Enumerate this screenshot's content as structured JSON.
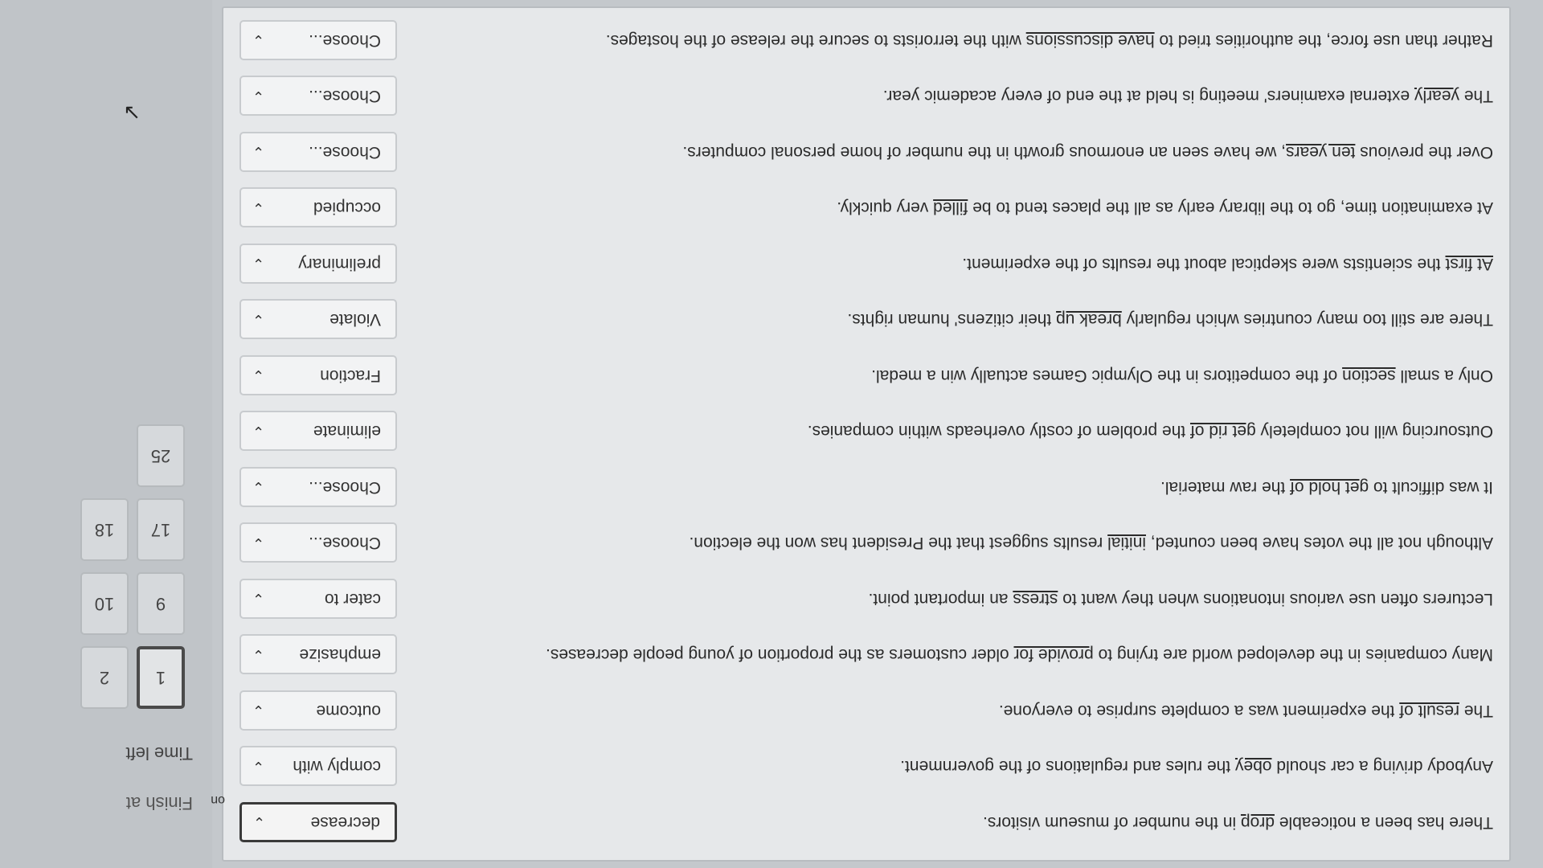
{
  "sidebar": {
    "finish_label": "Finish at",
    "time_label": "Time left",
    "side_label": "on",
    "nav": [
      "1",
      "2",
      "9",
      "10",
      "17",
      "18",
      "25"
    ]
  },
  "questions": [
    {
      "pre": "There has been a noticeable ",
      "u": "drop",
      "post": " in the number of museum visitors.",
      "answer": "decrease"
    },
    {
      "pre": "Anybody driving a car should ",
      "u": "obey",
      "post": " the rules and regulations of the government.",
      "answer": "comply with"
    },
    {
      "pre": "The ",
      "u": "result of",
      "post": " the experiment was a complete surprise to everyone.",
      "answer": "outcome"
    },
    {
      "pre": "Many companies in the developed world are trying to ",
      "u": "provide for",
      "post": " older customers as the proportion of young people decreases.",
      "answer": "emphasize"
    },
    {
      "pre": "Lecturers often use various intonations when they want to ",
      "u": "stress",
      "post": " an important point.",
      "answer": "cater to"
    },
    {
      "pre": "Although not all the votes have been counted, ",
      "u": "initial",
      "post": " results suggest that the President has won the election.",
      "answer": "Choose..."
    },
    {
      "pre": "It was difficult to ",
      "u": "get hold of",
      "post": " the raw material.",
      "answer": "Choose..."
    },
    {
      "pre": "Outsourcing will not completely ",
      "u": "get rid of",
      "post": " the problem of costly overheads within companies.",
      "answer": "eliminate"
    },
    {
      "pre": "Only a small ",
      "u": "section",
      "post": " of the competitors in the Olympic Games actually win a medal.",
      "answer": "Fraction"
    },
    {
      "pre": "There are still too many countries which regularly ",
      "u": "break up",
      "post": " their citizens' human rights.",
      "answer": "Violate"
    },
    {
      "pre": "",
      "u": "At first",
      "post": " the scientists were skeptical about the results of the experiment.",
      "answer": "preliminary"
    },
    {
      "pre": "At examination time, go to the library early as all the places tend to be ",
      "u": "filled",
      "post": " very quickly.",
      "answer": "occupied"
    },
    {
      "pre": "Over the previous ",
      "u": "ten years",
      "post": ", we have seen an enormous growth in the number of home personal computers.",
      "answer": "Choose..."
    },
    {
      "pre": "The ",
      "u": "yearly",
      "post": " external examiners' meeting is held at the end of every academic year.",
      "answer": "Choose..."
    },
    {
      "pre": "Rather than use force, the authorities tried to ",
      "u": "have discussions",
      "post": " with the terrorists to secure the release of the hostages.",
      "answer": "Choose..."
    }
  ]
}
